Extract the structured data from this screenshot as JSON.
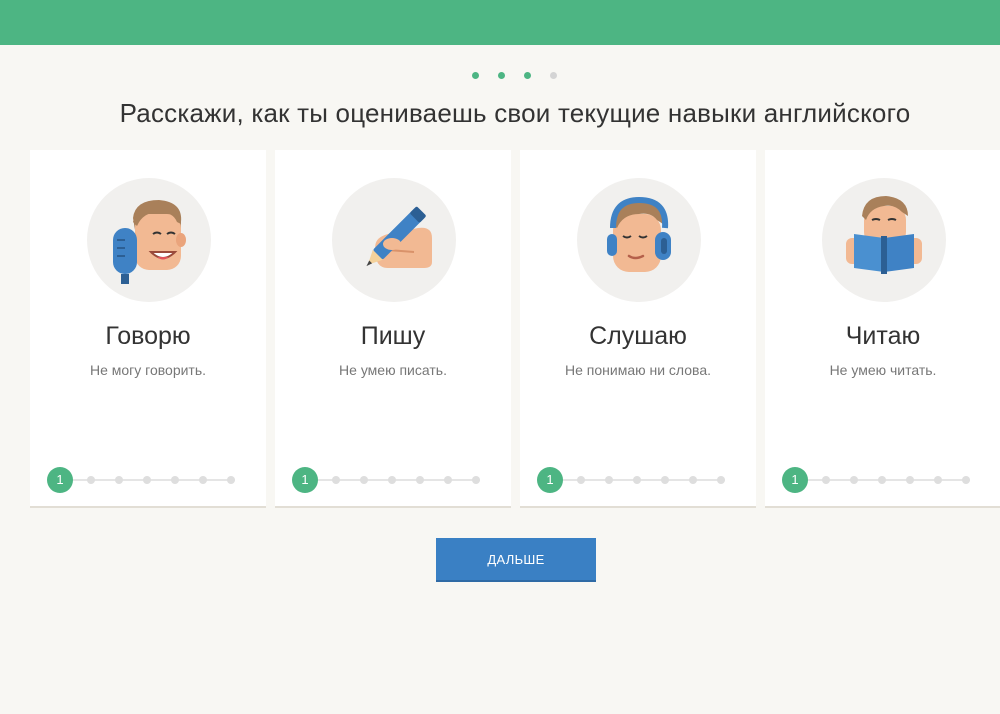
{
  "header": {
    "color": "#4db583"
  },
  "steps": {
    "total": 4,
    "completed": 3,
    "active_color": "#4db583",
    "inactive_color": "#d4d4d4"
  },
  "title": "Расскажи, как ты оцениваешь свои текущие навыки английского",
  "cards": [
    {
      "title": "Говорю",
      "description": "Не могу говорить.",
      "level": "1",
      "icon": "speaking-icon"
    },
    {
      "title": "Пишу",
      "description": "Не умею писать.",
      "level": "1",
      "icon": "writing-icon"
    },
    {
      "title": "Слушаю",
      "description": "Не понимаю ни слова.",
      "level": "1",
      "icon": "listening-icon"
    },
    {
      "title": "Читаю",
      "description": "Не умею читать.",
      "level": "1",
      "icon": "reading-icon"
    }
  ],
  "scale_points": 7,
  "next_button": {
    "label": "ДАЛЬШЕ",
    "color": "#3a80c4"
  }
}
